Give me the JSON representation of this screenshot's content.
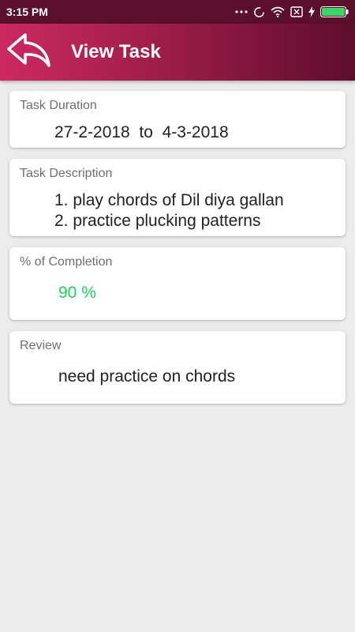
{
  "status_bar": {
    "time": "3:15 PM",
    "icons": [
      "more-dots-icon",
      "sync-icon",
      "wifi-icon",
      "sim-off-icon",
      "charging-icon",
      "battery-icon"
    ]
  },
  "app_bar": {
    "title": "View Task",
    "back_icon": "back-arrow-icon"
  },
  "cards": {
    "duration": {
      "label": "Task Duration",
      "value": "27-2-2018  to  4-3-2018"
    },
    "description": {
      "label": "Task Description",
      "lines": [
        "1. play chords of Dil diya gallan",
        "2. practice plucking patterns"
      ]
    },
    "completion": {
      "label": "% of Completion",
      "value": "90 %",
      "value_color": "#1fd15a"
    },
    "review": {
      "label": "Review",
      "value": "need practice on chords"
    }
  },
  "colors": {
    "app_bar_gradient_start": "#cc2a5f",
    "app_bar_gradient_end": "#5e0d2c",
    "status_bar": "#5a0f2c",
    "battery": "#3fd46a"
  }
}
